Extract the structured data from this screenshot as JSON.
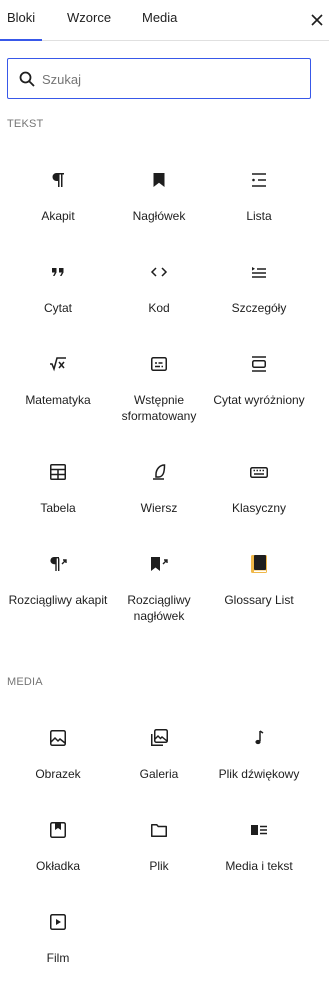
{
  "tabs": [
    {
      "label": "Bloki"
    },
    {
      "label": "Wzorce"
    },
    {
      "label": "Media"
    }
  ],
  "search": {
    "placeholder": "Szukaj"
  },
  "sections": [
    {
      "title": "TEKST",
      "blocks": [
        {
          "label": "Akapit",
          "icon": "paragraph-icon"
        },
        {
          "label": "Nagłówek",
          "icon": "heading-icon"
        },
        {
          "label": "Lista",
          "icon": "list-icon"
        },
        {
          "label": "Cytat",
          "icon": "quote-icon"
        },
        {
          "label": "Kod",
          "icon": "code-icon"
        },
        {
          "label": "Szczegóły",
          "icon": "details-icon"
        },
        {
          "label": "Matematyka",
          "icon": "math-icon"
        },
        {
          "label": "Wstępnie sformatowany",
          "icon": "preformatted-icon"
        },
        {
          "label": "Cytat wyróżniony",
          "icon": "pullquote-icon"
        },
        {
          "label": "Tabela",
          "icon": "table-icon"
        },
        {
          "label": "Wiersz",
          "icon": "verse-icon"
        },
        {
          "label": "Klasyczny",
          "icon": "keyboard-icon"
        },
        {
          "label": "Rozciągliwy akapit",
          "icon": "stretchy-paragraph-icon"
        },
        {
          "label": "Rozciągliwy nagłówek",
          "icon": "stretchy-heading-icon"
        },
        {
          "label": "Glossary List",
          "icon": "glossary-book-icon"
        }
      ]
    },
    {
      "title": "MEDIA",
      "blocks": [
        {
          "label": "Obrazek",
          "icon": "image-icon"
        },
        {
          "label": "Galeria",
          "icon": "gallery-icon"
        },
        {
          "label": "Plik dźwiękowy",
          "icon": "audio-icon"
        },
        {
          "label": "Okładka",
          "icon": "cover-icon"
        },
        {
          "label": "Plik",
          "icon": "file-icon"
        },
        {
          "label": "Media i tekst",
          "icon": "media-text-icon"
        },
        {
          "label": "Film",
          "icon": "video-icon"
        }
      ]
    }
  ],
  "colors": {
    "accent": "#3858e9",
    "glossary": "#f0b849"
  }
}
